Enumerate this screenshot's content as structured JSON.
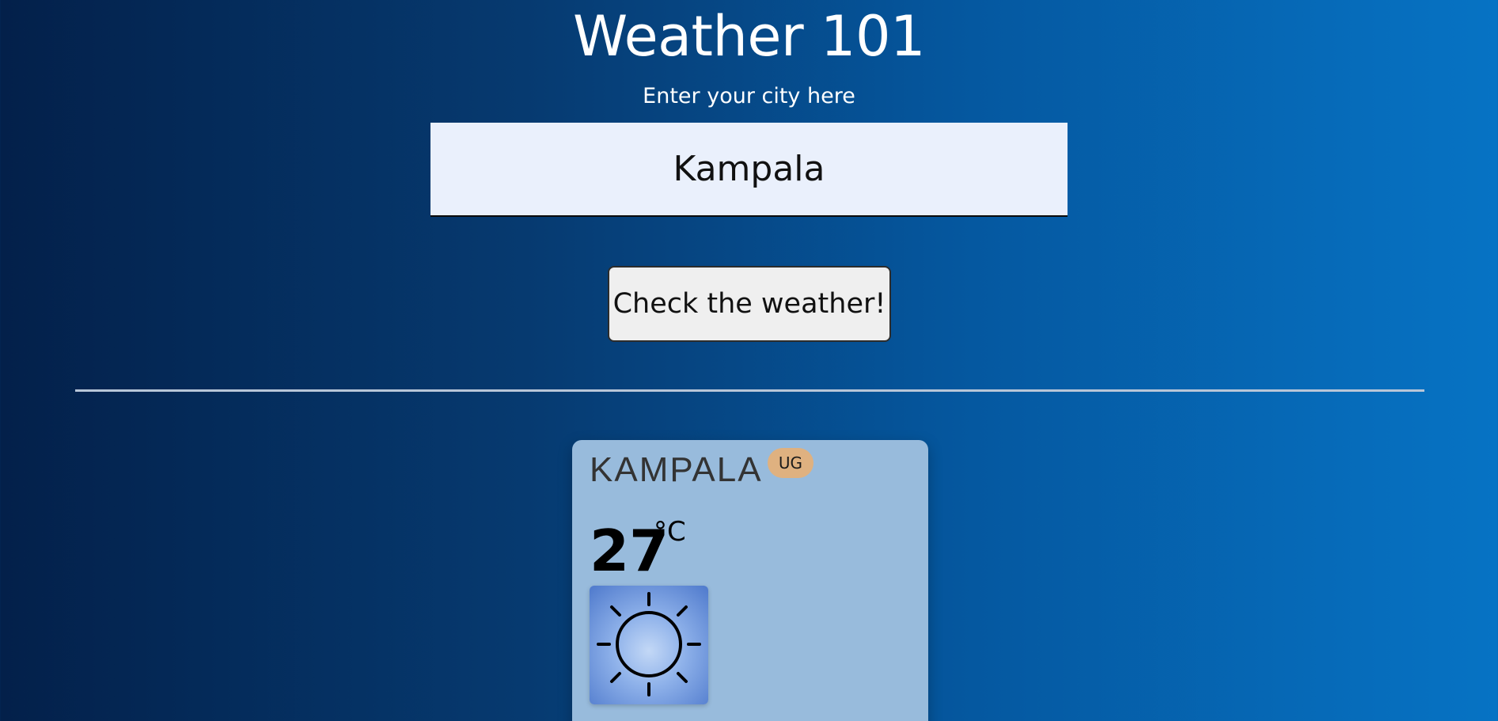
{
  "header": {
    "title": "Weather 101",
    "subtitle": "Enter your city here"
  },
  "search": {
    "value": "Kampala",
    "button_label": "Check the weather!"
  },
  "result": {
    "city": "KAMPALA",
    "country": "UG",
    "temperature": "27",
    "unit": "°C",
    "condition_icon": "sun-icon"
  }
}
